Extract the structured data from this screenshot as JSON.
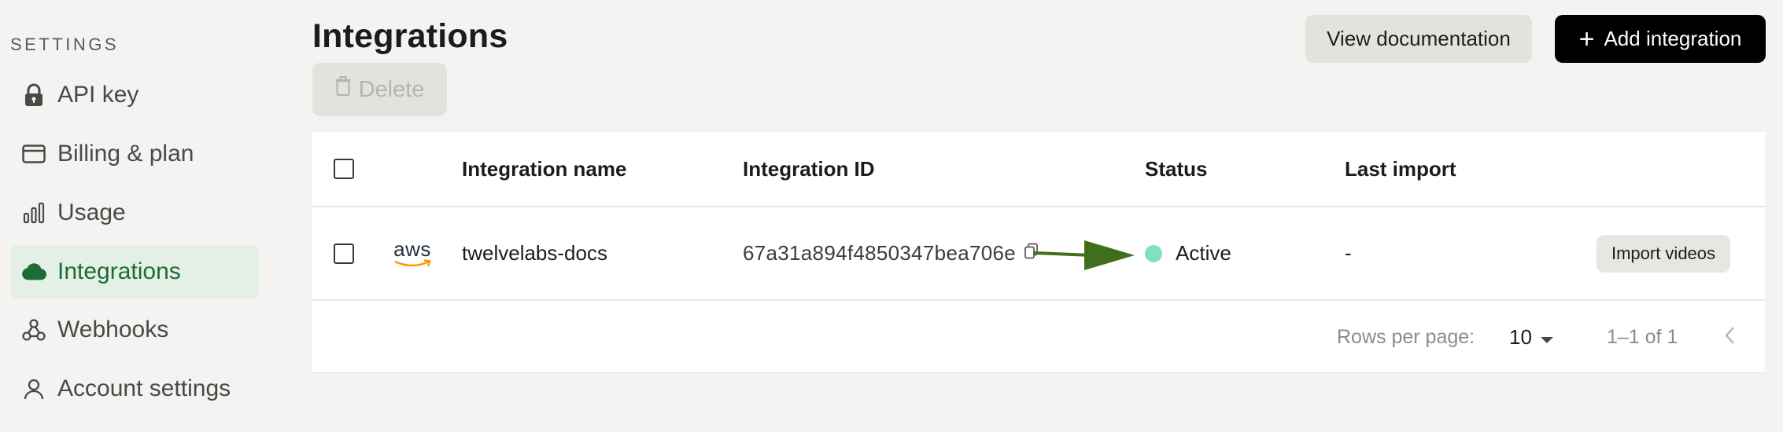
{
  "sidebar": {
    "heading": "SETTINGS",
    "items": [
      {
        "label": "API key",
        "icon": "lock-icon",
        "active": false
      },
      {
        "label": "Billing & plan",
        "icon": "credit-card-icon",
        "active": false
      },
      {
        "label": "Usage",
        "icon": "bar-chart-icon",
        "active": false
      },
      {
        "label": "Integrations",
        "icon": "cloud-icon",
        "active": true
      },
      {
        "label": "Webhooks",
        "icon": "webhook-icon",
        "active": false
      },
      {
        "label": "Account settings",
        "icon": "user-icon",
        "active": false
      }
    ]
  },
  "header": {
    "title": "Integrations",
    "view_docs_label": "View documentation",
    "add_integration_label": "Add integration",
    "delete_label": "Delete"
  },
  "table": {
    "columns": [
      "Integration name",
      "Integration ID",
      "Status",
      "Last import"
    ],
    "rows": [
      {
        "provider_logo_text": "aws",
        "name": "twelvelabs-docs",
        "id": "67a31a894f4850347bea706e",
        "status": "Active",
        "last_import": "-",
        "action_label": "Import videos"
      }
    ]
  },
  "pagination": {
    "rows_per_page_label": "Rows per page:",
    "rows_per_page_value": "10",
    "range_text": "1–1 of 1"
  },
  "colors": {
    "accent_active": "#1f6b36",
    "active_nav_bg": "#e4efe6",
    "status_active": "#7fe0c3",
    "annotation_arrow": "#3f6f1c"
  }
}
